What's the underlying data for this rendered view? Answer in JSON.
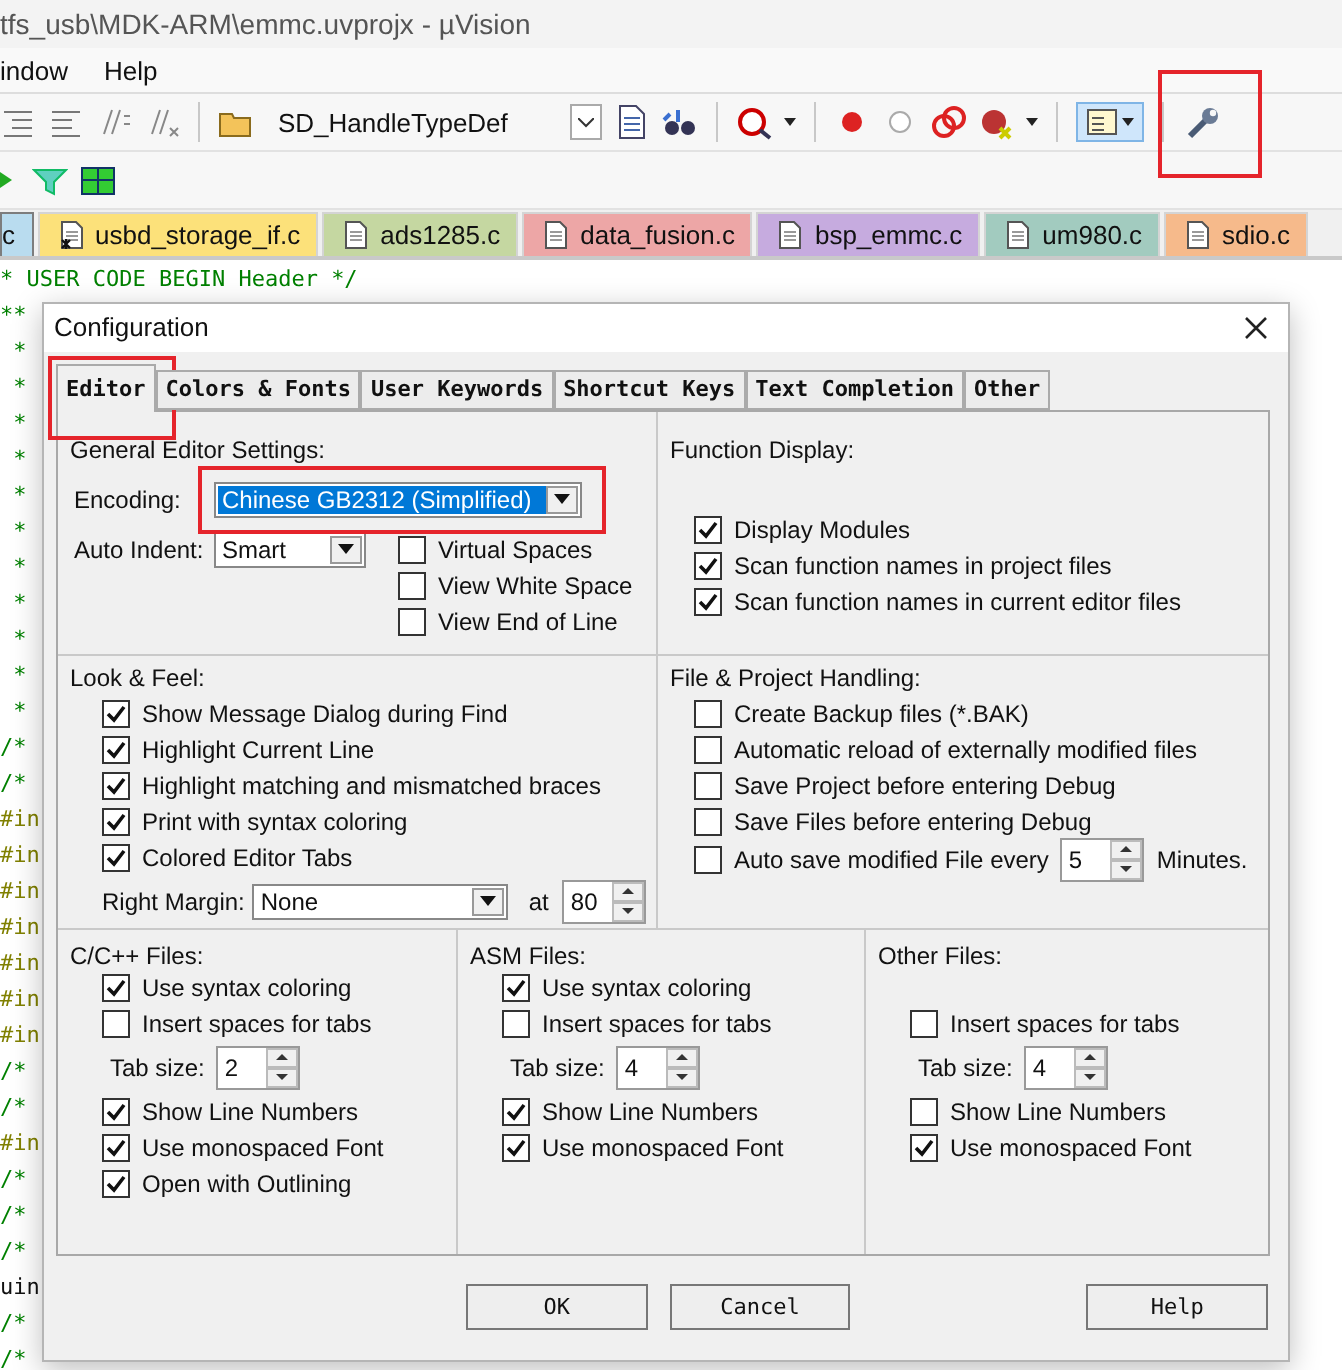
{
  "window": {
    "title": "tfs_usb\\MDK-ARM\\emmc.uvprojx - µVision"
  },
  "menu": [
    "indow",
    "Help"
  ],
  "toolbar": {
    "symbol": "SD_HandleTypeDef",
    "window_button_pressed": true,
    "settings_annotated": true
  },
  "file_tabs": [
    {
      "label": "c",
      "color": "#b9dcef",
      "selected": true,
      "modified": false
    },
    {
      "label": "usbd_storage_if.c",
      "color": "#fce17a",
      "selected": false,
      "modified": true
    },
    {
      "label": "ads1285.c",
      "color": "#c5d7a1",
      "selected": false,
      "modified": false
    },
    {
      "label": "data_fusion.c",
      "color": "#eda6a6",
      "selected": false,
      "modified": false
    },
    {
      "label": "bsp_emmc.c",
      "color": "#c6abdf",
      "selected": false,
      "modified": false
    },
    {
      "label": "um980.c",
      "color": "#a2cbbf",
      "selected": false,
      "modified": false
    },
    {
      "label": "sdio.c",
      "color": "#f6ba8b",
      "selected": false,
      "modified": false
    }
  ],
  "editor": {
    "lines": [
      {
        "text": "* USER CODE BEGIN Header */",
        "kind": "comment"
      },
      {
        "text": "**",
        "kind": "comment"
      },
      {
        "text": " *",
        "kind": "comment"
      },
      {
        "text": " *",
        "kind": "comment"
      },
      {
        "text": " *",
        "kind": "comment"
      },
      {
        "text": " *",
        "kind": "comment"
      },
      {
        "text": " *",
        "kind": "comment"
      },
      {
        "text": " *",
        "kind": "comment"
      },
      {
        "text": " *",
        "kind": "comment"
      },
      {
        "text": " *",
        "kind": "comment"
      },
      {
        "text": " *",
        "kind": "comment"
      },
      {
        "text": " *",
        "kind": "comment"
      },
      {
        "text": " *",
        "kind": "comment"
      },
      {
        "text": "/*",
        "kind": "comment"
      },
      {
        "text": "/*",
        "kind": "comment"
      },
      {
        "text": "#in",
        "kind": "directive"
      },
      {
        "text": "#in",
        "kind": "directive"
      },
      {
        "text": "#in",
        "kind": "directive"
      },
      {
        "text": "#in",
        "kind": "directive"
      },
      {
        "text": "#in",
        "kind": "directive"
      },
      {
        "text": "#in",
        "kind": "directive"
      },
      {
        "text": "#in",
        "kind": "directive"
      },
      {
        "text": "/*",
        "kind": "comment"
      },
      {
        "text": "/*",
        "kind": "comment"
      },
      {
        "text": "#in",
        "kind": "directive"
      },
      {
        "text": "/*",
        "kind": "comment"
      },
      {
        "text": "/*",
        "kind": "comment"
      },
      {
        "text": "/*",
        "kind": "comment"
      },
      {
        "text": "uin",
        "kind": "code"
      },
      {
        "text": "/*",
        "kind": "comment"
      },
      {
        "text": "/*",
        "kind": "comment"
      }
    ]
  },
  "dialog": {
    "title": "Configuration",
    "tabs": [
      {
        "label": "Editor",
        "selected": true,
        "annotated": true
      },
      {
        "label": "Colors & Fonts",
        "selected": false,
        "annotated": false
      },
      {
        "label": "User Keywords",
        "selected": false,
        "annotated": false
      },
      {
        "label": "Shortcut Keys",
        "selected": false,
        "annotated": false
      },
      {
        "label": "Text Completion",
        "selected": false,
        "annotated": false
      },
      {
        "label": "Other",
        "selected": false,
        "annotated": false
      }
    ],
    "general": {
      "heading": "General Editor Settings:",
      "encoding": {
        "label": "Encoding:",
        "value": "Chinese GB2312 (Simplified)",
        "annotated": true
      },
      "auto_indent": {
        "label": "Auto Indent:",
        "value": "Smart"
      },
      "options": [
        {
          "label": "Virtual Spaces",
          "checked": false
        },
        {
          "label": "View White Space",
          "checked": false
        },
        {
          "label": "View End of Line",
          "checked": false
        }
      ]
    },
    "function_display": {
      "heading": "Function Display:",
      "options": [
        {
          "label": "Display Modules",
          "checked": true
        },
        {
          "label": "Scan function names in project files",
          "checked": true
        },
        {
          "label": "Scan function names in current editor files",
          "checked": true
        }
      ]
    },
    "look_and_feel": {
      "heading": "Look & Feel:",
      "options": [
        {
          "label": "Show Message Dialog during Find",
          "checked": true
        },
        {
          "label": "Highlight Current Line",
          "checked": true
        },
        {
          "label": "Highlight matching and mismatched braces",
          "checked": true
        },
        {
          "label": "Print with syntax coloring",
          "checked": true
        },
        {
          "label": "Colored Editor Tabs",
          "checked": true
        }
      ],
      "right_margin": {
        "label": "Right Margin:",
        "value": "None",
        "at_label": "at",
        "column": "80"
      }
    },
    "file_handling": {
      "heading": "File & Project Handling:",
      "options": [
        {
          "label": "Create Backup files (*.BAK)",
          "checked": false
        },
        {
          "label": "Automatic reload of externally modified files",
          "checked": false
        },
        {
          "label": "Save Project before entering Debug",
          "checked": false
        },
        {
          "label": "Save Files before entering Debug",
          "checked": false
        }
      ],
      "auto_save": {
        "label": "Auto save modified File every",
        "checked": false,
        "value": "5",
        "unit": "Minutes."
      }
    },
    "file_types": [
      {
        "heading": "C/C++ Files:",
        "options_top": [
          {
            "label": "Use syntax coloring",
            "checked": true
          },
          {
            "label": "Insert spaces for tabs",
            "checked": false
          }
        ],
        "tab_size": {
          "label": "Tab size:",
          "value": "2"
        },
        "options_bottom": [
          {
            "label": "Show Line Numbers",
            "checked": true
          },
          {
            "label": "Use monospaced Font",
            "checked": true
          },
          {
            "label": "Open with Outlining",
            "checked": true
          }
        ]
      },
      {
        "heading": "ASM Files:",
        "options_top": [
          {
            "label": "Use syntax coloring",
            "checked": true
          },
          {
            "label": "Insert spaces for tabs",
            "checked": false
          }
        ],
        "tab_size": {
          "label": "Tab size:",
          "value": "4"
        },
        "options_bottom": [
          {
            "label": "Show Line Numbers",
            "checked": true
          },
          {
            "label": "Use monospaced Font",
            "checked": true
          }
        ]
      },
      {
        "heading": "Other Files:",
        "options_top": [
          {
            "label": "Insert spaces for tabs",
            "checked": false
          }
        ],
        "tab_size": {
          "label": "Tab size:",
          "value": "4"
        },
        "options_bottom": [
          {
            "label": "Show Line Numbers",
            "checked": false
          },
          {
            "label": "Use monospaced Font",
            "checked": true
          }
        ]
      }
    ],
    "buttons": [
      "OK",
      "Cancel",
      "Help"
    ]
  }
}
